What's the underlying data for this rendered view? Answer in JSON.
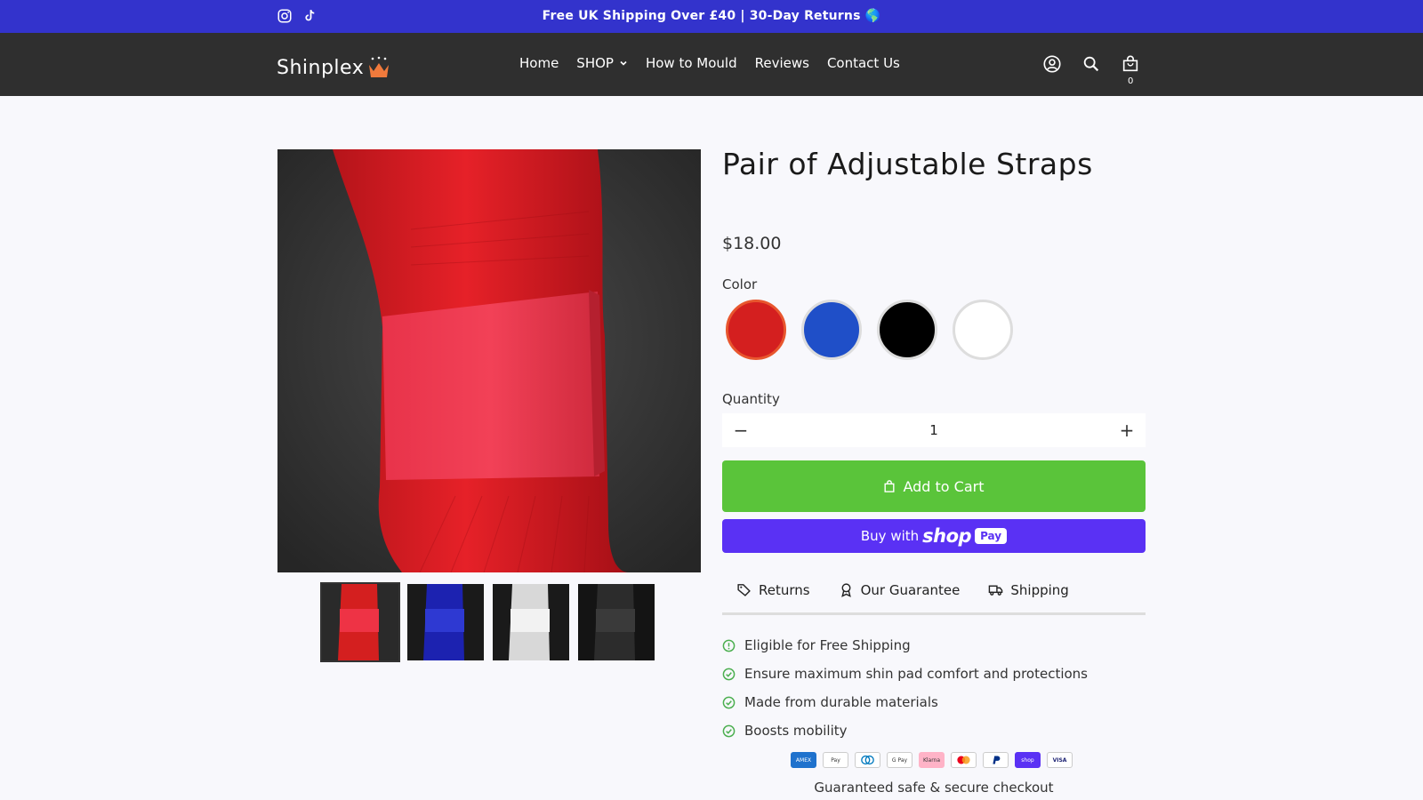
{
  "announcement": {
    "message": "Free UK Shipping Over £40 | 30-Day Returns 🌎",
    "socials": [
      "instagram-icon",
      "tiktok-icon"
    ]
  },
  "header": {
    "logo_text": "Shinplex",
    "nav": [
      {
        "label": "Home"
      },
      {
        "label": "SHOP",
        "has_dropdown": true
      },
      {
        "label": "How to Mould"
      },
      {
        "label": "Reviews"
      },
      {
        "label": "Contact Us"
      }
    ],
    "icons": [
      "account-icon",
      "search-icon",
      "cart-icon"
    ],
    "cart_count": "0"
  },
  "product": {
    "title": "Pair of Adjustable Straps",
    "price": "$18.00",
    "color_label": "Color",
    "colors": [
      {
        "name": "Red",
        "hex": "#d41f1f",
        "selected": true
      },
      {
        "name": "Blue",
        "hex": "#1f4fc8",
        "selected": false
      },
      {
        "name": "Black",
        "hex": "#000000",
        "selected": false
      },
      {
        "name": "White",
        "hex": "#ffffff",
        "selected": false
      }
    ],
    "quantity_label": "Quantity",
    "quantity": "1",
    "add_to_cart": "Add to Cart",
    "buy_with": "Buy with",
    "shop_brand": "shop",
    "pay_brand": "Pay",
    "thumbnails": [
      "red",
      "blue",
      "white",
      "black"
    ]
  },
  "tabs": [
    {
      "label": "Returns",
      "icon": "tag-icon"
    },
    {
      "label": "Our Guarantee",
      "icon": "award-icon"
    },
    {
      "label": "Shipping",
      "icon": "truck-icon"
    }
  ],
  "features": [
    {
      "text": "Eligible for Free Shipping",
      "icon": "info-circle-icon"
    },
    {
      "text": "Ensure maximum shin pad comfort and protections",
      "icon": "check-circle-icon"
    },
    {
      "text": "Made from durable materials",
      "icon": "check-circle-icon"
    },
    {
      "text": "Boosts mobility",
      "icon": "check-circle-icon"
    }
  ],
  "payments": [
    "amex",
    "apple-pay",
    "diners",
    "google-pay",
    "klarna",
    "mastercard",
    "paypal",
    "shop-pay",
    "visa"
  ],
  "secure_text": "Guaranteed safe & secure checkout",
  "colors": {
    "announcement_bg": "#3333cc",
    "header_bg": "#2f2f2f",
    "add_to_cart_bg": "#5ac43a",
    "shop_pay_bg": "#5a31f4",
    "accent": "#e8562e",
    "feature_check": "#4caf50"
  }
}
